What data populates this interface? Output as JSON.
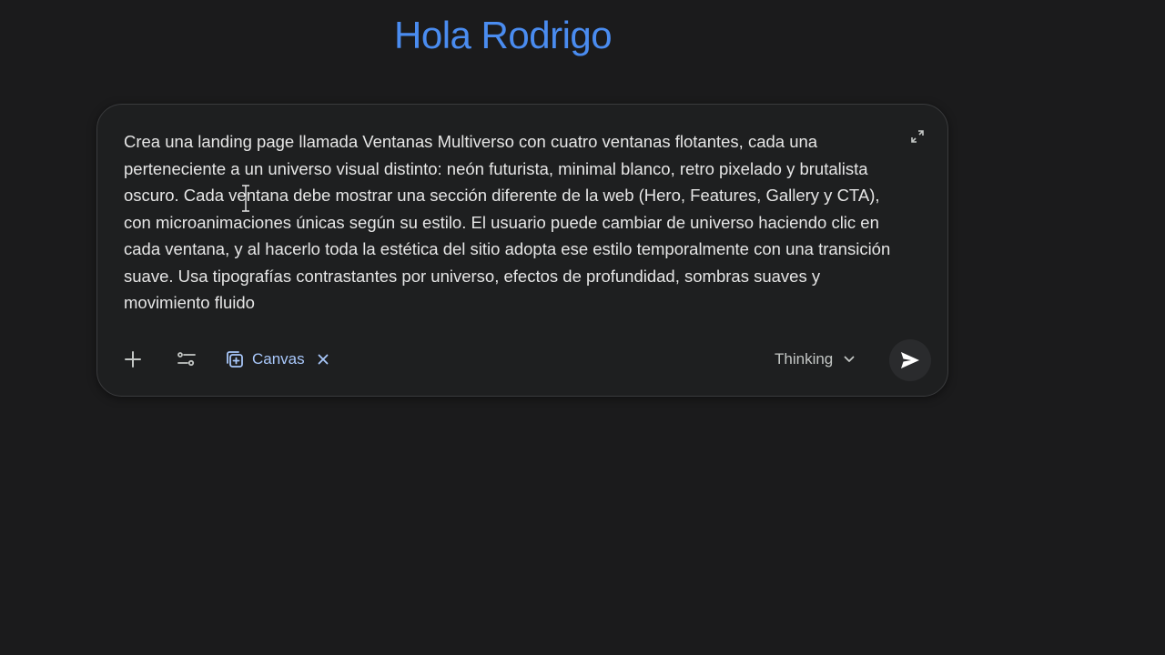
{
  "greeting": "Hola Rodrigo",
  "composer": {
    "prompt": "Crea una landing page llamada Ventanas Multiverso con cuatro ventanas flotantes, cada una perteneciente a un universo visual distinto: neón futurista, minimal blanco, retro pixelado y brutalista oscuro. Cada ventana debe mostrar una sección diferente de la web (Hero, Features, Gallery y CTA), con microanimaciones únicas según su estilo. El usuario puede cambiar de universo haciendo clic en cada ventana, y al hacerlo toda la estética del sitio adopta ese estilo temporalmente con una transición suave. Usa tipografías contrastantes por universo, efectos de profundidad, sombras suaves y movimiento fluido",
    "tools": {
      "add_icon": "plus-icon",
      "tools_icon": "sliders-icon",
      "canvas_label": "Canvas",
      "canvas_icon": "canvas-icon",
      "canvas_close_icon": "close-icon"
    },
    "model_label": "Thinking",
    "send_icon": "send-icon",
    "expand_icon": "expand-icon"
  },
  "colors": {
    "background": "#1b1b1c",
    "greeting": "#4a8cf0",
    "composer_bg": "#1e1f20",
    "canvas_chip": "#a8c7fa",
    "text": "#e6e6e6"
  }
}
